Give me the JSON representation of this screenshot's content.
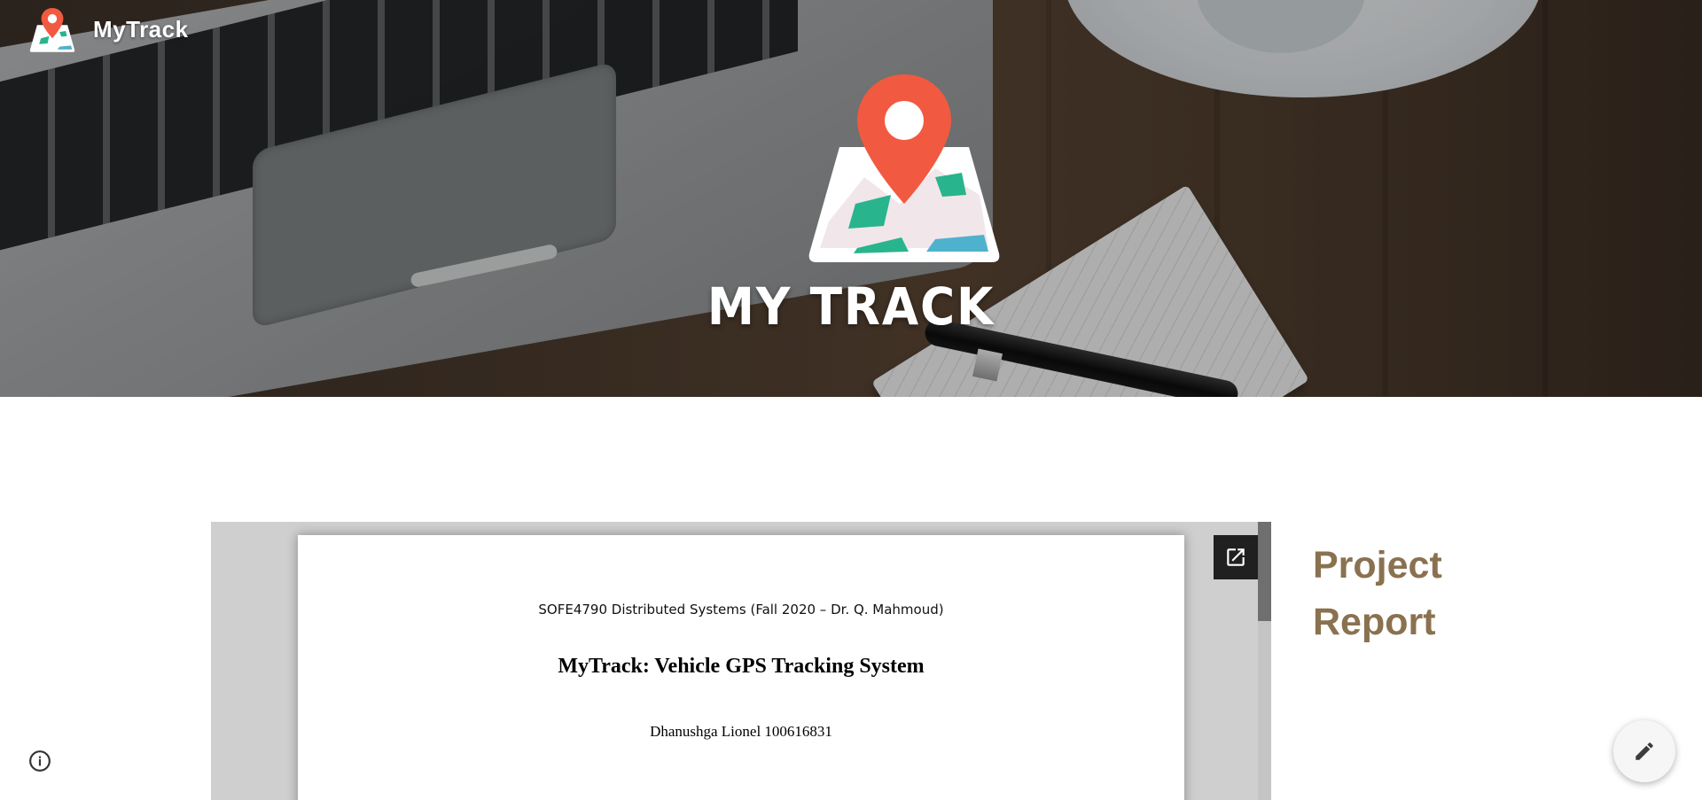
{
  "header": {
    "site_title": "MyTrack",
    "logo_icon": "map-pin-logo-icon"
  },
  "hero": {
    "logo_text": "MY TRACK",
    "logo_icon": "map-pin-logo-icon",
    "accent_color": "#f15a40"
  },
  "doc_embed": {
    "course_line": "SOFE4790 Distributed Systems (Fall 2020 – Dr. Q. Mahmoud)",
    "title": "MyTrack: Vehicle GPS Tracking System",
    "author": "Dhanushga Lionel 100616831",
    "popout_icon": "open-in-new-icon"
  },
  "side": {
    "heading": "Project Report",
    "heading_color": "#8a7150"
  },
  "floating": {
    "info_icon": "info-icon",
    "edit_icon": "pencil-icon"
  }
}
